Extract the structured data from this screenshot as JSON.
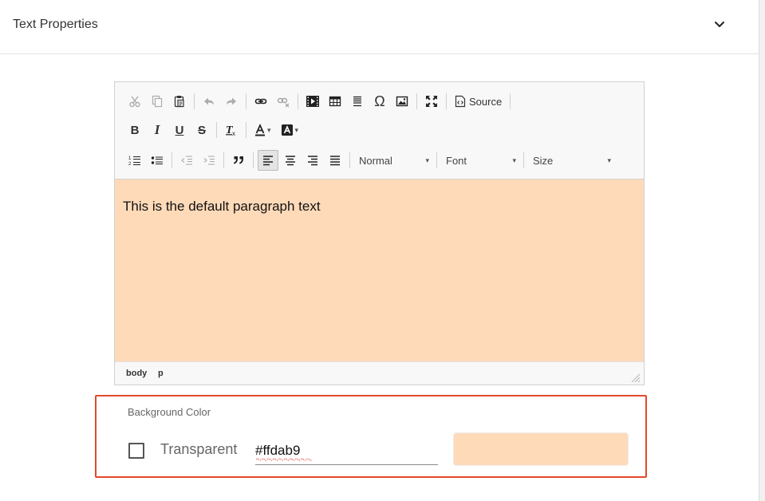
{
  "panel": {
    "title": "Text Properties",
    "toggle_icon": "chevron-down-icon"
  },
  "toolbar": {
    "row1": [
      {
        "name": "cut-icon",
        "enabled": false
      },
      {
        "name": "copy-icon",
        "enabled": false
      },
      {
        "name": "paste-icon",
        "enabled": true
      },
      {
        "name": "undo-icon",
        "enabled": false
      },
      {
        "name": "redo-icon",
        "enabled": false
      },
      {
        "name": "link-icon",
        "enabled": true
      },
      {
        "name": "unlink-icon",
        "enabled": false
      },
      {
        "name": "media-embed-icon",
        "enabled": true
      },
      {
        "name": "table-icon",
        "enabled": true
      },
      {
        "name": "horizontal-line-icon",
        "enabled": true
      },
      {
        "name": "special-character-icon",
        "enabled": true
      },
      {
        "name": "image-icon",
        "enabled": true
      },
      {
        "name": "maximize-icon",
        "enabled": true
      },
      {
        "name": "source-icon",
        "enabled": true
      }
    ],
    "source_label": "Source",
    "bold_label": "B",
    "italic_label": "I",
    "underline_label": "U",
    "strike_label": "S",
    "row3_format_combo": {
      "value": "Normal"
    },
    "row3_font_combo": {
      "value": "Font"
    },
    "row3_size_combo": {
      "value": "Size"
    },
    "active_alignment": "align-left"
  },
  "editor": {
    "content_text": "This is the default paragraph text",
    "background_color": "#ffdab9",
    "path": [
      "body",
      "p"
    ]
  },
  "background_color_field": {
    "label": "Background Color",
    "transparent_label": "Transparent",
    "transparent_checked": false,
    "hex_value": "#ffdab9",
    "swatch_color": "#ffdab9",
    "highlight_color": "#e24a2b"
  }
}
